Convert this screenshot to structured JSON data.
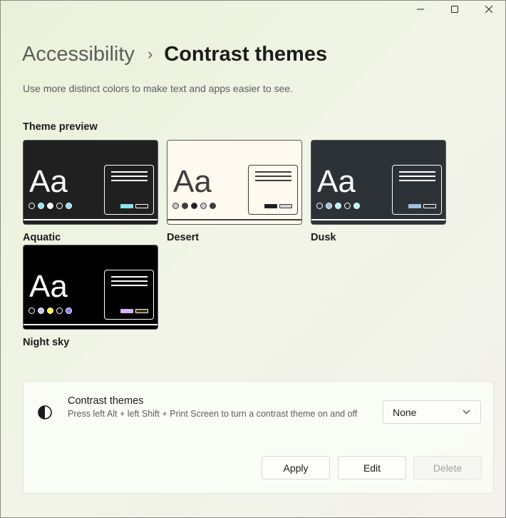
{
  "window": {
    "minimize_icon": "minimize-icon",
    "maximize_icon": "maximize-icon",
    "close_icon": "close-icon"
  },
  "breadcrumb": {
    "parent": "Accessibility",
    "separator": "›",
    "current": "Contrast themes"
  },
  "description": "Use more distinct colors to make text and apps easier to see.",
  "theme_preview": {
    "label": "Theme preview",
    "sample_text": "Aa",
    "themes": [
      {
        "name": "Aquatic",
        "bg": "#202020",
        "fg": "#ffffff",
        "line": "#ffffff",
        "dots": [
          "#202020",
          "#8ee3f0",
          "#ffffff",
          "#202020",
          "#8ee3f0"
        ],
        "btn1": "#8ee3f0",
        "btn2": "#202020"
      },
      {
        "name": "Desert",
        "bg": "#fffaef",
        "fg": "#3d3d3d",
        "line": "#3d3d3d",
        "dots": [
          "#c8c8c8",
          "#3d3d3d",
          "#202020",
          "#c8c8c8",
          "#3d3d3d"
        ],
        "btn1": "#202020",
        "btn2": "#d4d4d4"
      },
      {
        "name": "Dusk",
        "bg": "#2d3236",
        "fg": "#ffffff",
        "line": "#ffffff",
        "dots": [
          "#2d3236",
          "#a1bfde",
          "#b6f6f0",
          "#2d3236",
          "#b6f6f0"
        ],
        "btn1": "#a1bfde",
        "btn2": "#2d3236"
      },
      {
        "name": "Night sky",
        "bg": "#000000",
        "fg": "#ffffff",
        "line": "#ffffff",
        "dots": [
          "#000000",
          "#d6b4fd",
          "#ffee32",
          "#000000",
          "#8080ff"
        ],
        "btn1": "#d6b4fd",
        "btn2": "#3a3a10"
      }
    ]
  },
  "contrast_setting": {
    "icon": "contrast-icon",
    "title": "Contrast themes",
    "description": "Press left Alt + left Shift + Print Screen to turn a contrast theme on and off",
    "dropdown_value": "None",
    "apply_label": "Apply",
    "edit_label": "Edit",
    "delete_label": "Delete"
  }
}
